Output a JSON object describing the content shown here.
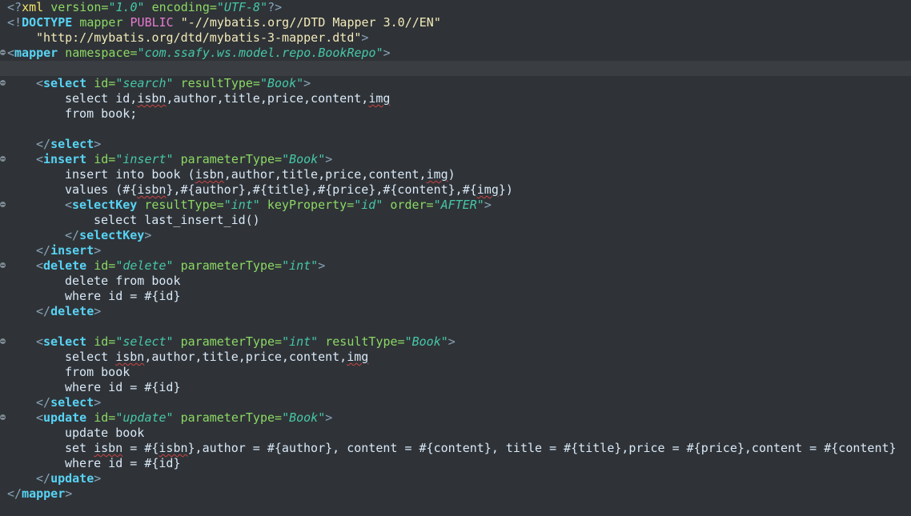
{
  "editor": {
    "theme": {
      "background": "#2f3337",
      "current_line": "#3a3e42",
      "tag": "#58d3f5",
      "attr": "#8cd865",
      "value": "#46c7a8",
      "text": "#d9e8f7"
    },
    "lines": {
      "l1": {
        "open": "<?",
        "name": "xml",
        "a1": "version=",
        "v1": "\"1.0\"",
        "a2": "encoding=",
        "v2": "\"UTF-8\"",
        "close": "?>"
      },
      "l2": {
        "open": "<!",
        "name": "DOCTYPE",
        "rest1": "mapper",
        "kw": "PUBLIC",
        "str": "\"-//mybatis.org//DTD Mapper 3.0//EN\""
      },
      "l3": {
        "str": "\"http://mybatis.org/dtd/mybatis-3-mapper.dtd\"",
        "close": ">"
      },
      "l4": {
        "open": "<",
        "name": "mapper",
        "a1": "namespace=",
        "v1": "\"com.ssafy.ws.model.repo.BookRepo\"",
        "close": ">"
      },
      "l6": {
        "open": "<",
        "name": "select",
        "a1": "id=",
        "v1": "\"search\"",
        "a2": "resultType=",
        "v2": "\"Book\"",
        "close": ">"
      },
      "l7": {
        "t1": "select id,",
        "sq1": "isbn",
        "t2": ",author,title,price,content,",
        "sq2": "img"
      },
      "l8": {
        "t1": "from book;"
      },
      "l10": {
        "open": "</",
        "name": "select",
        "close": ">"
      },
      "l11": {
        "open": "<",
        "name": "insert",
        "a1": "id=",
        "v1": "\"insert\"",
        "a2": "parameterType=",
        "v2": "\"Book\"",
        "close": ">"
      },
      "l12": {
        "t1": "insert into book (",
        "sq1": "isbn",
        "t2": ",author,title,price,content,",
        "sq2": "img",
        "t3": ")"
      },
      "l13": {
        "t1": "values (#{",
        "sq1": "isbn",
        "t2": "},#{author},#{title},#{price},#{content},#{",
        "sq2": "img",
        "t3": "})"
      },
      "l14": {
        "open": "<",
        "name": "selectKey",
        "a1": "resultType=",
        "v1": "\"int\"",
        "a2": "keyProperty=",
        "v2": "\"id\"",
        "a3": "order=",
        "v3": "\"AFTER\"",
        "close": ">"
      },
      "l15": {
        "t1": "select last_insert_id()"
      },
      "l16": {
        "open": "</",
        "name": "selectKey",
        "close": ">"
      },
      "l17": {
        "open": "</",
        "name": "insert",
        "close": ">"
      },
      "l18": {
        "open": "<",
        "name": "delete",
        "a1": "id=",
        "v1": "\"delete\"",
        "a2": "parameterType=",
        "v2": "\"int\"",
        "close": ">"
      },
      "l19": {
        "t1": "delete from book"
      },
      "l20": {
        "t1": "where id = #{id}"
      },
      "l21": {
        "open": "</",
        "name": "delete",
        "close": ">"
      },
      "l23": {
        "open": "<",
        "name": "select",
        "a1": "id=",
        "v1": "\"select\"",
        "a2": "parameterType=",
        "v2": "\"int\"",
        "a3": "resultType=",
        "v3": "\"Book\"",
        "close": ">"
      },
      "l24": {
        "t1": "select ",
        "sq1": "isbn",
        "t2": ",author,title,price,content,",
        "sq2": "img"
      },
      "l25": {
        "t1": "from book"
      },
      "l26": {
        "t1": "where id = #{id}"
      },
      "l27": {
        "open": "</",
        "name": "select",
        "close": ">"
      },
      "l28": {
        "open": "<",
        "name": "update",
        "a1": "id=",
        "v1": "\"update\"",
        "a2": "parameterType=",
        "v2": "\"Book\"",
        "close": ">"
      },
      "l29": {
        "t1": "update book"
      },
      "l30": {
        "t1": "set ",
        "sq1": "isbn",
        "t2": " = #{",
        "sq2": "isbn",
        "t3": "},author = #{author}, content = #{content}, title = #{title},price = #{price},content = #{content}"
      },
      "l31": {
        "t1": "where id = #{id}"
      },
      "l32": {
        "open": "</",
        "name": "update",
        "close": ">"
      },
      "l33": {
        "open": "</",
        "name": "mapper",
        "close": ">"
      }
    }
  }
}
